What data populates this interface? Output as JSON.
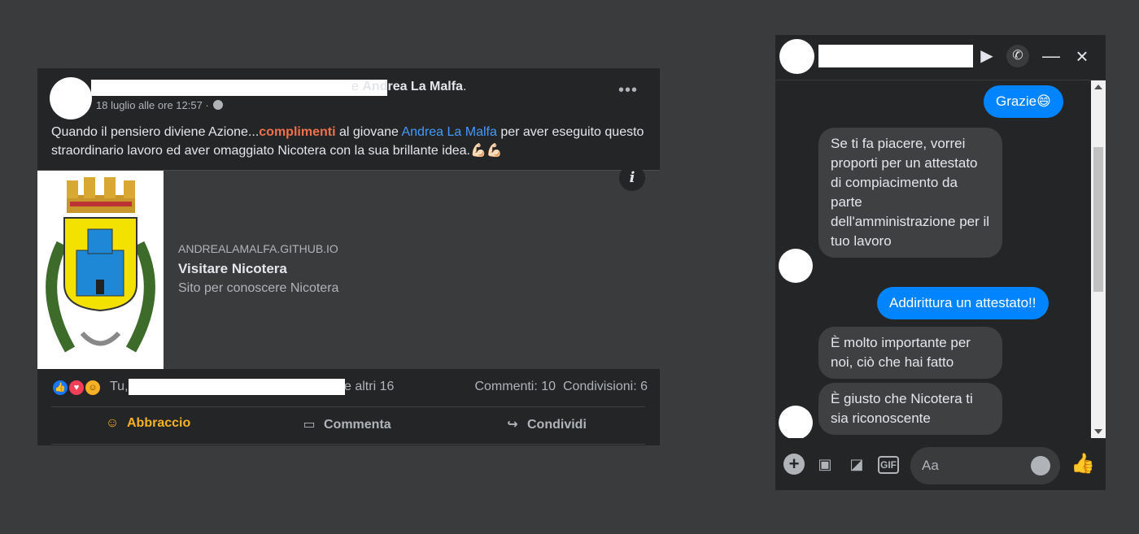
{
  "post": {
    "author_joiner": "e",
    "author_name": "Andrea La Malfa",
    "author_suffix": ".",
    "timestamp": "18 luglio alle ore 12:57 ·",
    "more_label": "•••",
    "text_part1": "Quando il pensiero diviene Azione...",
    "text_highlight": "complimenti",
    "text_part2": " al giovane ",
    "text_mention": "Andrea La Malfa",
    "text_part3": "  per aver eseguito questo straordinario lavoro ed aver omaggiato Nicotera con la sua brillante idea.",
    "text_emoji": "💪🏻💪🏻",
    "link": {
      "domain": "ANDREALAMALFA.GITHUB.IO",
      "title": "Visitare Nicotera",
      "description": "Sito per conoscere Nicotera",
      "info_icon": "i"
    },
    "reactions": {
      "prefix": "Tu,",
      "suffix": "e altri 16",
      "comments": "Commenti: 10",
      "shares": "Condivisioni: 6"
    },
    "actions": {
      "hug": "Abbraccio",
      "comment": "Commenta",
      "share": "Condividi"
    },
    "colors": {
      "accent_red": "#f0714b",
      "mention_blue": "#4599ff",
      "hug_yellow": "#f7b125"
    }
  },
  "chat": {
    "messages": [
      {
        "from": "me",
        "text": "Grazie😄"
      },
      {
        "from": "them",
        "text": "Se ti fa piacere, vorrei proporti per un attestato di compiacimento da parte dell'amministrazione per il tuo lavoro"
      },
      {
        "from": "me",
        "text": "Addirittura un attestato!!"
      },
      {
        "from": "them",
        "text": "È molto importante per noi, ciò che hai fatto"
      },
      {
        "from": "them",
        "text": "È giusto che Nicotera ti sia riconoscente"
      }
    ],
    "composer_placeholder": "Aa",
    "gif_label": "GIF",
    "colors": {
      "outgoing": "#0084ff",
      "incoming": "#3e4042"
    }
  }
}
